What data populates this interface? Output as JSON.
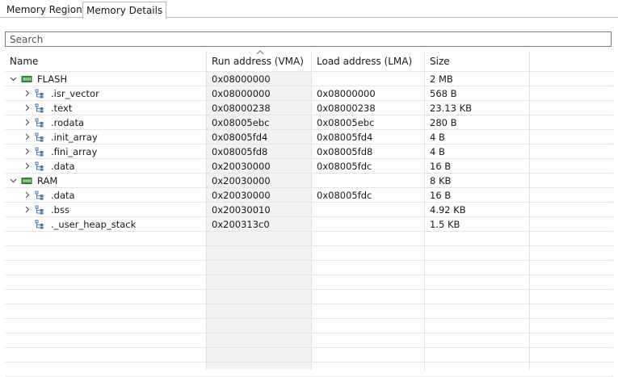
{
  "tabs": [
    {
      "label": "Memory Regions",
      "active": false
    },
    {
      "label": "Memory Details",
      "active": true
    }
  ],
  "search": {
    "placeholder": "Search",
    "value": ""
  },
  "columns": [
    "Name",
    "Run address (VMA)",
    "Load address (LMA)",
    "Size"
  ],
  "sort_column": "Run address (VMA)",
  "rows": [
    {
      "level": 0,
      "icon": "memory-region-icon",
      "expander": "expanded",
      "name": "FLASH",
      "vma": "0x08000000",
      "lma": "",
      "size": "2 MB"
    },
    {
      "level": 1,
      "icon": "section-tree-icon",
      "expander": "collapsed",
      "name": ".isr_vector",
      "vma": "0x08000000",
      "lma": "0x08000000",
      "size": "568 B"
    },
    {
      "level": 1,
      "icon": "section-tree-icon",
      "expander": "collapsed",
      "name": ".text",
      "vma": "0x08000238",
      "lma": "0x08000238",
      "size": "23.13 KB"
    },
    {
      "level": 1,
      "icon": "section-tree-icon",
      "expander": "collapsed",
      "name": ".rodata",
      "vma": "0x08005ebc",
      "lma": "0x08005ebc",
      "size": "280 B"
    },
    {
      "level": 1,
      "icon": "section-tree-icon",
      "expander": "collapsed",
      "name": ".init_array",
      "vma": "0x08005fd4",
      "lma": "0x08005fd4",
      "size": "4 B"
    },
    {
      "level": 1,
      "icon": "section-tree-icon",
      "expander": "collapsed",
      "name": ".fini_array",
      "vma": "0x08005fd8",
      "lma": "0x08005fd8",
      "size": "4 B"
    },
    {
      "level": 1,
      "icon": "section-tree-icon",
      "expander": "collapsed",
      "name": ".data",
      "vma": "0x20030000",
      "lma": "0x08005fdc",
      "size": "16 B"
    },
    {
      "level": 0,
      "icon": "memory-region-icon",
      "expander": "expanded",
      "name": "RAM",
      "vma": "0x20030000",
      "lma": "",
      "size": "8 KB"
    },
    {
      "level": 1,
      "icon": "section-tree-icon",
      "expander": "collapsed",
      "name": ".data",
      "vma": "0x20030000",
      "lma": "0x08005fdc",
      "size": "16 B"
    },
    {
      "level": 1,
      "icon": "section-tree-icon",
      "expander": "collapsed",
      "name": ".bss",
      "vma": "0x20030010",
      "lma": "",
      "size": "4.92 KB"
    },
    {
      "level": 1,
      "icon": "section-tree-icon",
      "expander": "none",
      "name": "._user_heap_stack",
      "vma": "0x200313c0",
      "lma": "",
      "size": "1.5 KB"
    }
  ],
  "colors": {
    "accent_green": "#3c9a3c",
    "section_icon": "#4a78b0"
  }
}
